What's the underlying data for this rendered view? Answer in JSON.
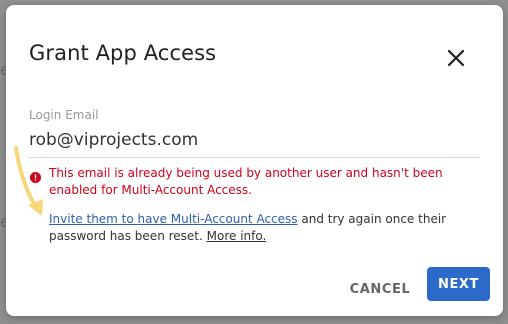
{
  "background": {
    "hint_one": "e",
    "hint_two": "e"
  },
  "dialog": {
    "title": "Grant App Access",
    "close_icon": "close-icon",
    "field": {
      "label": "Login Email",
      "value": "rob@viprojects.com"
    },
    "error": {
      "icon": "error-icon",
      "text": "This email is already being used by another user and hasn't been enabled for Multi-Account Access."
    },
    "help": {
      "link_text": "Invite them to have Multi-Account Access",
      "middle_text": " and try again once their password has been reset. ",
      "more_link": "More info."
    },
    "buttons": {
      "cancel": "CANCEL",
      "next": "NEXT"
    }
  },
  "colors": {
    "error": "#d0021b",
    "link": "#2f5fb3",
    "primary": "#2b6ac9",
    "annotation_arrow": "#f6d77a"
  },
  "annotation": {
    "icon": "arrow-annotation"
  }
}
